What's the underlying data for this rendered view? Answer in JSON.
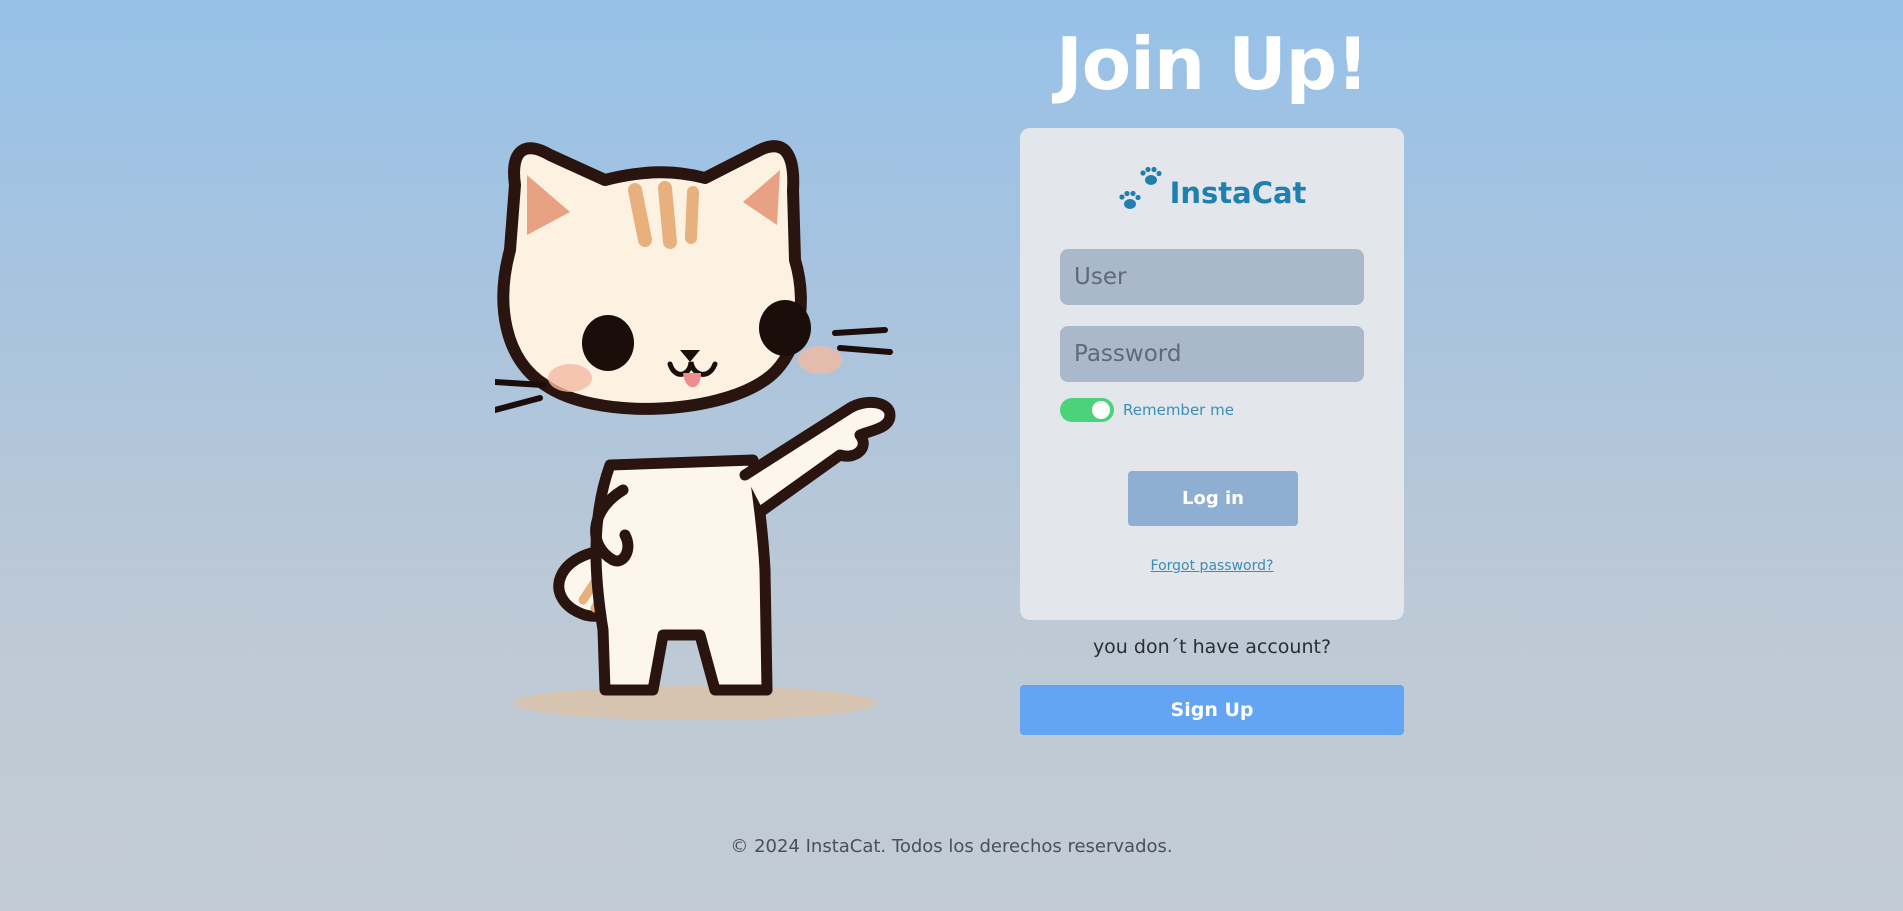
{
  "header": {
    "title": "Join Up!"
  },
  "brand": {
    "name": "InstaCat",
    "icon": "paw-icon",
    "color": "#1f7fae"
  },
  "form": {
    "user_placeholder": "User",
    "password_placeholder": "Password",
    "remember_label": "Remember me",
    "remember_on": true,
    "login_label": "Log in",
    "forgot_label": "Forgot password?"
  },
  "signup": {
    "prompt": "you don´t have account?",
    "button_label": "Sign Up"
  },
  "footer": {
    "text": "© 2024 InstaCat. Todos los derechos reservados."
  },
  "illustration": {
    "icon": "cat-mascot-illustration"
  },
  "colors": {
    "toggle_on": "#4cd27a",
    "login_button": "#8eaed2",
    "signup_button": "#64a4f4",
    "input_bg": "#a9b8ca",
    "card_bg": "#e3e6eb"
  }
}
